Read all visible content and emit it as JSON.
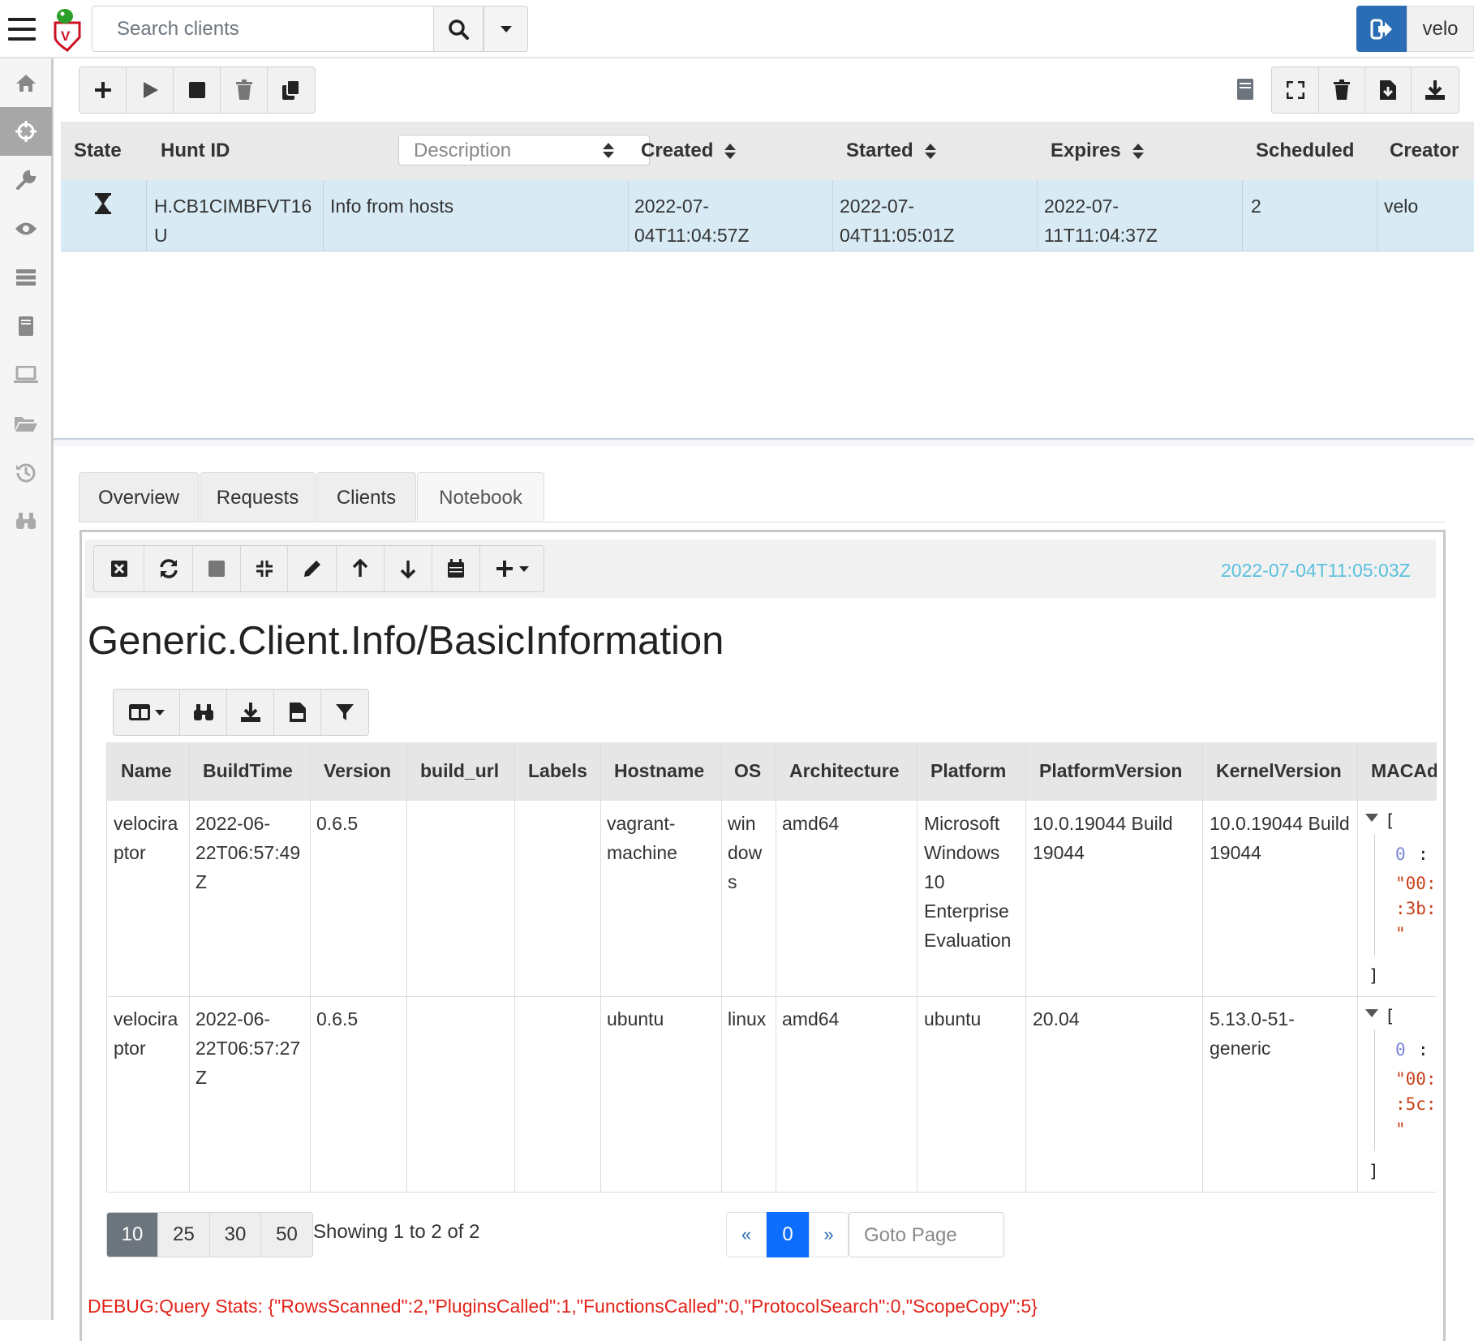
{
  "topbar": {
    "search_placeholder": "Search clients",
    "user": "velo"
  },
  "hunt_table": {
    "headers": {
      "state": "State",
      "hunt_id": "Hunt ID",
      "description_placeholder": "Description",
      "created": "Created",
      "started": "Started",
      "expires": "Expires",
      "scheduled": "Scheduled",
      "creator": "Creator"
    },
    "rows": [
      {
        "state_icon": "hourglass-icon",
        "hunt_id_1": "H.CB1CIMBFVT16",
        "hunt_id_2": "U",
        "description": "Info from hosts",
        "created_1": "2022-07-",
        "created_2": "04T11:04:57Z",
        "started_1": "2022-07-",
        "started_2": "04T11:05:01Z",
        "expires_1": "2022-07-",
        "expires_2": "11T11:04:37Z",
        "scheduled": "2",
        "creator": "velo"
      }
    ]
  },
  "tabs": [
    "Overview",
    "Requests",
    "Clients",
    "Notebook"
  ],
  "notebook": {
    "timestamp": "2022-07-04T11:05:03Z",
    "title": "Generic.Client.Info/BasicInformation"
  },
  "results": {
    "headers": [
      "Name",
      "BuildTime",
      "Version",
      "build_url",
      "Labels",
      "Hostname",
      "OS",
      "Architecture",
      "Platform",
      "PlatformVersion",
      "KernelVersion",
      "MACAd"
    ],
    "rows": [
      {
        "name": [
          "velocira",
          "ptor"
        ],
        "buildtime": [
          "2022-06-",
          "22T06:57:49",
          "Z"
        ],
        "version": "0.6.5",
        "hostname": [
          "vagrant-",
          "machine"
        ],
        "os": [
          "win",
          "dow",
          "s"
        ],
        "arch": "amd64",
        "platform": [
          "Microsoft",
          "Windows",
          "10",
          "Enterprise",
          "Evaluation"
        ],
        "platform_version": [
          "10.0.19044 Build",
          "19044"
        ],
        "kernel_version": [
          "10.0.19044 Build",
          "19044"
        ],
        "mac": {
          "open": "[",
          "index": "0",
          "colon": ":",
          "v1": "\"00:",
          "v2": ":3b:",
          "v3": "\"",
          "close": "]"
        }
      },
      {
        "name": [
          "velocira",
          "ptor"
        ],
        "buildtime": [
          "2022-06-",
          "22T06:57:27",
          "Z"
        ],
        "version": "0.6.5",
        "hostname": [
          "ubuntu"
        ],
        "os": [
          "linux"
        ],
        "arch": "amd64",
        "platform": [
          "ubuntu"
        ],
        "platform_version": [
          "20.04"
        ],
        "kernel_version": [
          "5.13.0-51-",
          "generic"
        ],
        "mac": {
          "open": "[",
          "index": "0",
          "colon": ":",
          "v1": "\"00:",
          "v2": ":5c:",
          "v3": "\"",
          "close": "]"
        }
      }
    ]
  },
  "pagination": {
    "page_sizes": [
      "10",
      "25",
      "30",
      "50"
    ],
    "showing": "Showing 1 to 2 of 2",
    "prev": "«",
    "current": "0",
    "next": "»",
    "goto_placeholder": "Goto Page"
  },
  "debug": "DEBUG:Query Stats: {\"RowsScanned\":2,\"PluginsCalled\":1,\"FunctionsCalled\":0,\"ProtocolSearch\":0,\"ScopeCopy\":5}",
  "colors": {
    "accent": "#2a6db4",
    "selected_row": "#d8ebf5",
    "timestamp": "#5bc0de",
    "debug": "#e2241a",
    "json_string": "#c7401a",
    "json_index": "#7a86d8"
  }
}
